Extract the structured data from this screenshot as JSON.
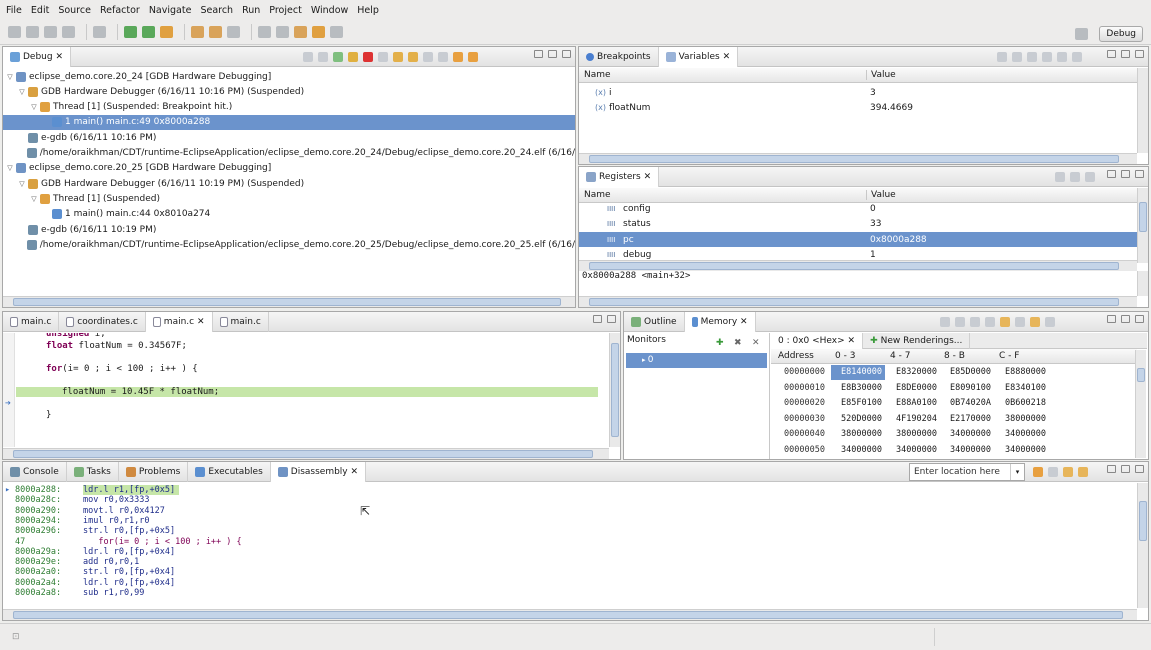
{
  "menu": [
    "File",
    "Edit",
    "Source",
    "Refactor",
    "Navigate",
    "Search",
    "Run",
    "Project",
    "Window",
    "Help"
  ],
  "perspective": {
    "label": "Debug"
  },
  "debug_view": {
    "tab": "Debug",
    "tree": [
      {
        "indent": 0,
        "twisty": "▽",
        "icon": "launch",
        "text": "eclipse_demo.core.20_24 [GDB Hardware Debugging]"
      },
      {
        "indent": 1,
        "twisty": "▽",
        "icon": "debugger",
        "text": "GDB Hardware Debugger (6/16/11 10:16 PM) (Suspended)"
      },
      {
        "indent": 2,
        "twisty": "▽",
        "icon": "thread",
        "text": "Thread [1] (Suspended: Breakpoint hit.)"
      },
      {
        "indent": 3,
        "twisty": "",
        "icon": "frame",
        "text": "1 main() main.c:49 0x8000a288",
        "selected": true
      },
      {
        "indent": 1,
        "twisty": "",
        "icon": "process",
        "text": "e-gdb (6/16/11 10:16 PM)"
      },
      {
        "indent": 1,
        "twisty": "",
        "icon": "process",
        "text": "/home/oraikhman/CDT/runtime-EclipseApplication/eclipse_demo.core.20_24/Debug/eclipse_demo.core.20_24.elf (6/16/"
      },
      {
        "indent": 0,
        "twisty": "▽",
        "icon": "launch",
        "text": "eclipse_demo.core.20_25 [GDB Hardware Debugging]"
      },
      {
        "indent": 1,
        "twisty": "▽",
        "icon": "debugger",
        "text": "GDB Hardware Debugger (6/16/11 10:19 PM) (Suspended)"
      },
      {
        "indent": 2,
        "twisty": "▽",
        "icon": "thread",
        "text": "Thread [1] (Suspended)"
      },
      {
        "indent": 3,
        "twisty": "",
        "icon": "frame",
        "text": "1 main() main.c:44 0x8010a274"
      },
      {
        "indent": 1,
        "twisty": "",
        "icon": "process",
        "text": "e-gdb (6/16/11 10:19 PM)"
      },
      {
        "indent": 1,
        "twisty": "",
        "icon": "process",
        "text": "/home/oraikhman/CDT/runtime-EclipseApplication/eclipse_demo.core.20_25/Debug/eclipse_demo.core.20_25.elf (6/16/"
      }
    ]
  },
  "variables_view": {
    "tabs": [
      "Breakpoints",
      "Variables"
    ],
    "columns": [
      "Name",
      "Value"
    ],
    "rows": [
      {
        "name": "i",
        "value": "3"
      },
      {
        "name": "floatNum",
        "value": "394.4669"
      }
    ]
  },
  "registers_view": {
    "tab": "Registers",
    "columns": [
      "Name",
      "Value"
    ],
    "rows": [
      {
        "name": "config",
        "value": "0"
      },
      {
        "name": "status",
        "value": "33"
      },
      {
        "name": "pc",
        "value": "0x8000a288",
        "selected": true
      },
      {
        "name": "debug",
        "value": "1"
      }
    ],
    "detail": "0x8000a288 <main+32>"
  },
  "editor": {
    "tabs": [
      "main.c",
      "coordinates.c",
      "main.c",
      "main.c"
    ],
    "lines": [
      {
        "kw": "unsigned",
        "rest": " i;",
        "indent": 0
      },
      {
        "kw": "float",
        "rest": " floatNum = 0.34567F;",
        "indent": 0
      },
      {
        "kw": "",
        "rest": "",
        "indent": 0
      },
      {
        "kw": "for",
        "rest": "(i= 0 ; i < 100 ; i++ ) {",
        "indent": 0
      },
      {
        "kw": "",
        "rest": "",
        "indent": 0
      },
      {
        "kw": "",
        "rest": "floatNum = 10.45F * floatNum;",
        "indent": 1,
        "highlight": true
      },
      {
        "kw": "",
        "rest": "",
        "indent": 0
      },
      {
        "kw": "",
        "rest": "}",
        "indent": 0
      }
    ]
  },
  "outline_memory": {
    "tabs": [
      "Outline",
      "Memory"
    ],
    "monitors_label": "Monitors",
    "monitor_item": "0",
    "rendering_tabs": [
      "0 : 0x0 <Hex>",
      "New Renderings..."
    ],
    "columns": [
      "Address",
      "0 - 3",
      "4 - 7",
      "8 - B",
      "C - F"
    ],
    "rows": [
      [
        "00000000",
        "E8140000",
        "E8320000",
        "E85D0000",
        "E8880000"
      ],
      [
        "00000010",
        "E8B30000",
        "E8DE0000",
        "E8090100",
        "E8340100"
      ],
      [
        "00000020",
        "E85F0100",
        "E88A0100",
        "0B74020A",
        "0B600218"
      ],
      [
        "00000030",
        "520D0000",
        "4F190204",
        "E2170000",
        "38000000"
      ],
      [
        "00000040",
        "38000000",
        "38000000",
        "34000000",
        "34000000"
      ],
      [
        "00000050",
        "34000000",
        "34000000",
        "34000000",
        "34000000"
      ]
    ]
  },
  "bottom_view": {
    "tabs": [
      "Console",
      "Tasks",
      "Problems",
      "Executables",
      "Disassembly"
    ],
    "location_placeholder": "Enter location here",
    "lines": [
      {
        "addr": "8000a288:",
        "ins": "ldr.l r1,[fp,+0x5]",
        "current": true
      },
      {
        "addr": "8000a28c:",
        "ins": "mov r0,0x3333"
      },
      {
        "addr": "8000a290:",
        "ins": "movt.l r0,0x4127"
      },
      {
        "addr": "8000a294:",
        "ins": "imul r0,r1,r0"
      },
      {
        "addr": "8000a296:",
        "ins": "str.l r0,[fp,+0x5]"
      },
      {
        "addr": "47",
        "ins": "   for(i= 0 ; i < 100 ; i++ ) {",
        "source": true
      },
      {
        "addr": "8000a29a:",
        "ins": "ldr.l r0,[fp,+0x4]"
      },
      {
        "addr": "8000a29e:",
        "ins": "add r0,r0,1"
      },
      {
        "addr": "8000a2a0:",
        "ins": "str.l r0,[fp,+0x4]"
      },
      {
        "addr": "8000a2a4:",
        "ins": "ldr.l r0,[fp,+0x4]"
      },
      {
        "addr": "8000a2a8:",
        "ins": "sub r1,r0,99"
      }
    ]
  },
  "colors": {
    "selection": "#6b93cc",
    "code_highlight": "#c6e6a8",
    "memory_selected": "#6b93cc",
    "address_green": "#2e7d32"
  }
}
